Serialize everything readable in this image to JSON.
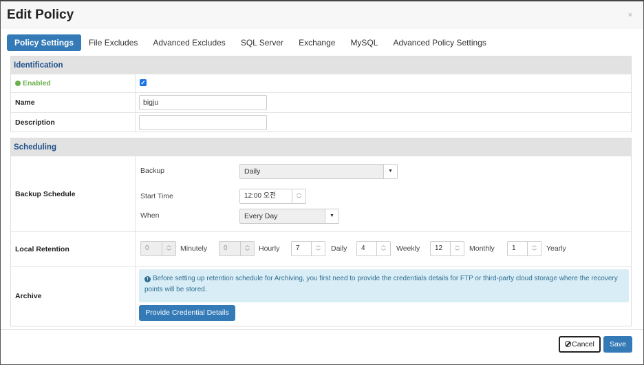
{
  "modal": {
    "title": "Edit Policy",
    "close": "×"
  },
  "tabs": [
    {
      "label": "Policy Settings",
      "active": true
    },
    {
      "label": "File Excludes"
    },
    {
      "label": "Advanced Excludes"
    },
    {
      "label": "SQL Server"
    },
    {
      "label": "Exchange"
    },
    {
      "label": "MySQL"
    },
    {
      "label": "Advanced Policy Settings"
    }
  ],
  "identification": {
    "header": "Identification",
    "enabled_label": "Enabled",
    "enabled_checked": true,
    "name_label": "Name",
    "name_value": "bigju",
    "description_label": "Description",
    "description_value": ""
  },
  "scheduling": {
    "header": "Scheduling",
    "backup_schedule_label": "Backup Schedule",
    "backup_label": "Backup",
    "backup_value": "Daily",
    "start_time_label": "Start Time",
    "start_time_value": "12:00 오전",
    "when_label": "When",
    "when_value": "Every Day",
    "local_retention_label": "Local Retention",
    "retention": [
      {
        "value": "0",
        "unit": "Minutely",
        "disabled": true
      },
      {
        "value": "0",
        "unit": "Hourly",
        "disabled": true
      },
      {
        "value": "7",
        "unit": "Daily"
      },
      {
        "value": "4",
        "unit": "Weekly"
      },
      {
        "value": "12",
        "unit": "Monthly"
      },
      {
        "value": "1",
        "unit": "Yearly"
      }
    ],
    "archive_label": "Archive",
    "archive_info": "Before setting up retention schedule for Archiving, you first need to provide the credentials details for FTP or third-party cloud storage where the recovery points will be stored.",
    "credential_button": "Provide Credential Details"
  },
  "footer": {
    "cancel": "Cancel",
    "save": "Save"
  },
  "colors": {
    "primary": "#337ab7",
    "enabled_green": "#6ab04c",
    "info_bg": "#d9edf7",
    "section_header_text": "#1e4f8a"
  }
}
